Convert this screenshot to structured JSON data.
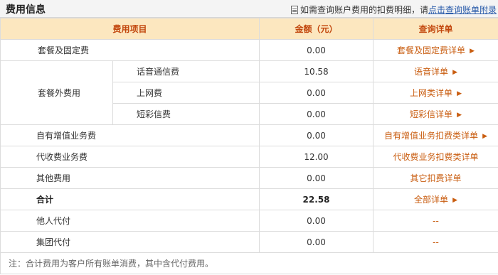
{
  "header": {
    "title": "费用信息",
    "hint_prefix": "如需查询账户费用的扣费明细，请",
    "hint_link": "点击查询账单附录"
  },
  "table": {
    "columns": [
      "费用项目",
      "金额（元）",
      "查询详单"
    ],
    "rows": {
      "package_fee": {
        "name": "套餐及固定费",
        "amount": "0.00",
        "link": "套餐及固定费详单"
      },
      "extra_group": "套餐外费用",
      "voice": {
        "name": "话音通信费",
        "amount": "10.58",
        "link": "语音详单"
      },
      "internet": {
        "name": "上网费",
        "amount": "0.00",
        "link": "上网类详单"
      },
      "sms": {
        "name": "短彩信费",
        "amount": "0.00",
        "link": "短彩信详单"
      },
      "vas": {
        "name": "自有增值业务费",
        "amount": "0.00",
        "link": "自有增值业务扣费类详单"
      },
      "collection": {
        "name": "代收费业务费",
        "amount": "12.00",
        "link": "代收费业务扣费类详单"
      },
      "other": {
        "name": "其他费用",
        "amount": "0.00",
        "link": "其它扣费详单"
      },
      "total": {
        "name": "合计",
        "amount": "22.58",
        "link": "全部详单"
      },
      "others_pay": {
        "name": "他人代付",
        "amount": "0.00",
        "link": "--"
      },
      "group_pay": {
        "name": "集团代付",
        "amount": "0.00",
        "link": "--"
      }
    },
    "note": "注：合计费用为客户所有账单消费，其中含代付费用。"
  },
  "colors": {
    "header_bg": "#fce7bf",
    "header_text": "#c2470d",
    "link": "#c95d10",
    "hint_link": "#2457a8"
  }
}
